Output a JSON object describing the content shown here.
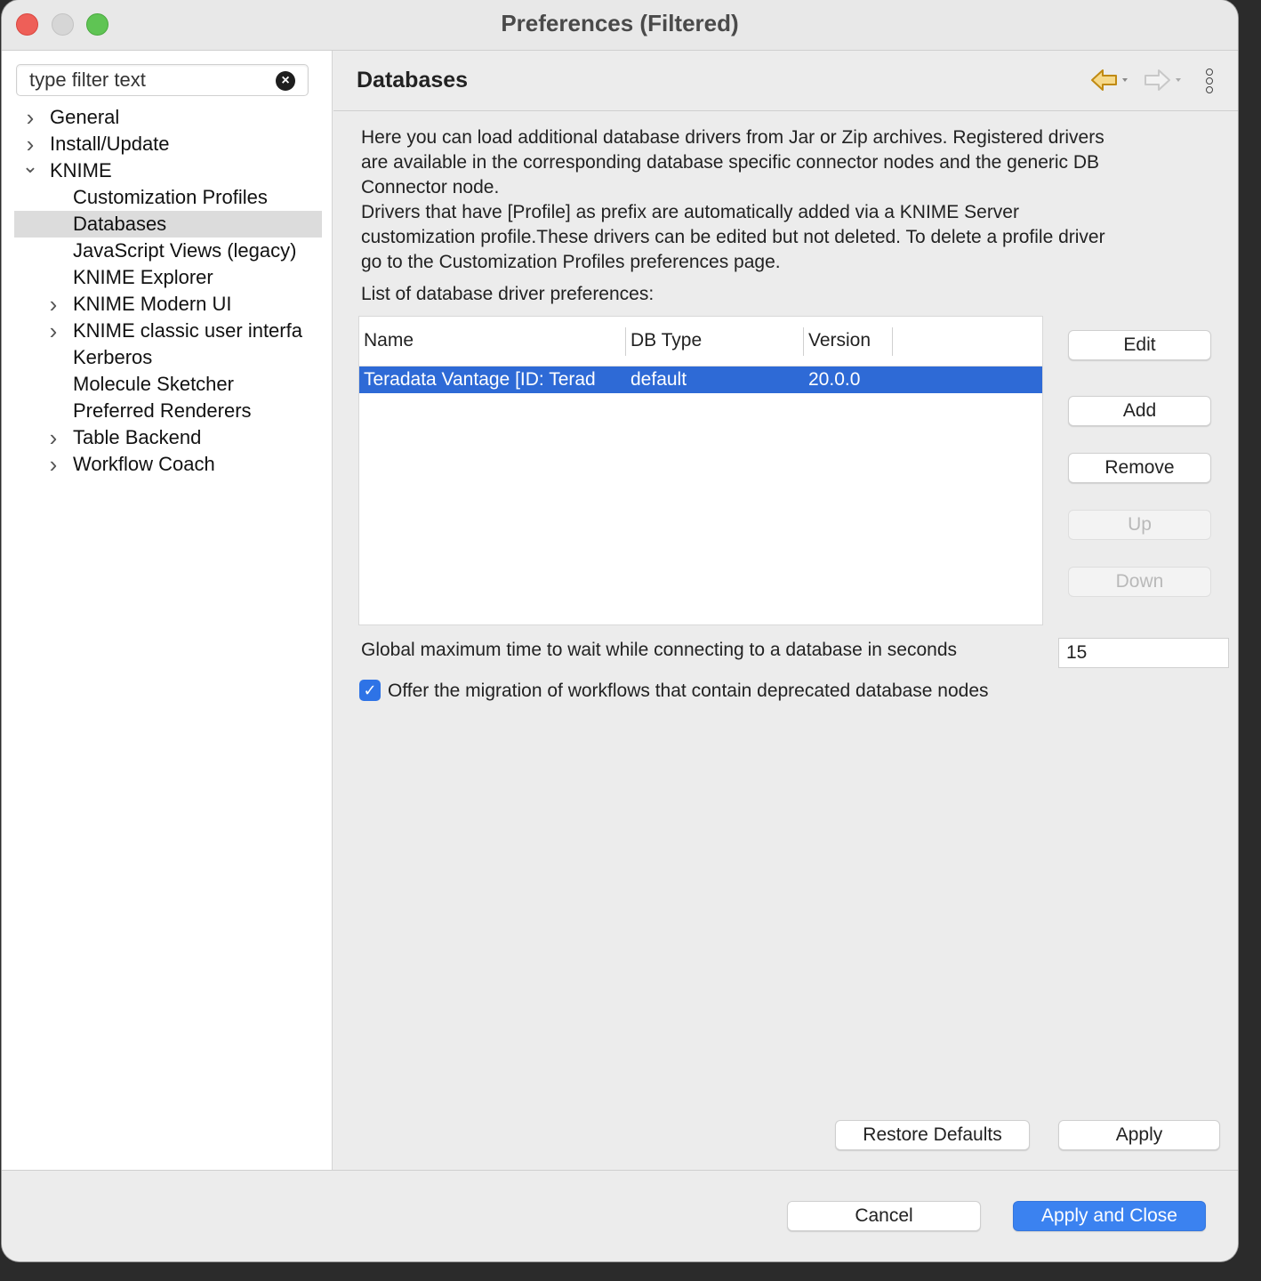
{
  "window": {
    "title": "Preferences (Filtered)"
  },
  "filter": {
    "placeholder": "type filter text"
  },
  "tree": [
    {
      "label": "General",
      "level": 0,
      "expander": "collapsed"
    },
    {
      "label": "Install/Update",
      "level": 0,
      "expander": "collapsed"
    },
    {
      "label": "KNIME",
      "level": 0,
      "expander": "expanded"
    },
    {
      "label": "Customization Profiles",
      "level": 1,
      "expander": "none"
    },
    {
      "label": "Databases",
      "level": 1,
      "expander": "none",
      "selected": true
    },
    {
      "label": "JavaScript Views (legacy)",
      "level": 1,
      "expander": "none"
    },
    {
      "label": "KNIME Explorer",
      "level": 1,
      "expander": "none"
    },
    {
      "label": "KNIME Modern UI",
      "level": 1,
      "expander": "collapsed"
    },
    {
      "label": "KNIME classic user interfa",
      "level": 1,
      "expander": "collapsed"
    },
    {
      "label": "Kerberos",
      "level": 1,
      "expander": "none"
    },
    {
      "label": "Molecule Sketcher",
      "level": 1,
      "expander": "none"
    },
    {
      "label": "Preferred Renderers",
      "level": 1,
      "expander": "none"
    },
    {
      "label": "Table Backend",
      "level": 1,
      "expander": "collapsed"
    },
    {
      "label": "Workflow Coach",
      "level": 1,
      "expander": "collapsed"
    }
  ],
  "page": {
    "title": "Databases",
    "description_lines": [
      "Here you can load additional database drivers from Jar or Zip archives. Registered drivers",
      "are available in the corresponding database specific connector nodes and the generic DB",
      "Connector node.",
      "Drivers that have [Profile] as prefix are automatically added via a KNIME Server",
      "customization profile.These drivers can be edited but not deleted. To delete a profile driver",
      "go to the Customization Profiles preferences page."
    ],
    "list_label": "List of database driver preferences:",
    "table": {
      "columns": [
        "Name",
        "DB Type",
        "Version"
      ],
      "rows": [
        {
          "name": "Teradata Vantage [ID: Terad",
          "db_type": "default",
          "version": "20.0.0",
          "selected": true
        }
      ]
    },
    "buttons": {
      "edit": "Edit",
      "add": "Add",
      "remove": "Remove",
      "up": "Up",
      "down": "Down"
    },
    "timeout": {
      "label": "Global maximum time to wait while connecting to a database in seconds",
      "value": "15"
    },
    "migration": {
      "label": "Offer the migration of workflows that contain deprecated database nodes",
      "checked": true
    },
    "restore_defaults": "Restore Defaults",
    "apply": "Apply"
  },
  "footer": {
    "cancel": "Cancel",
    "apply_and_close": "Apply and Close"
  },
  "colors": {
    "selection": "#2e6ad6",
    "primary_button": "#3b82f0",
    "nav_back_arrow": "#e8b230"
  }
}
